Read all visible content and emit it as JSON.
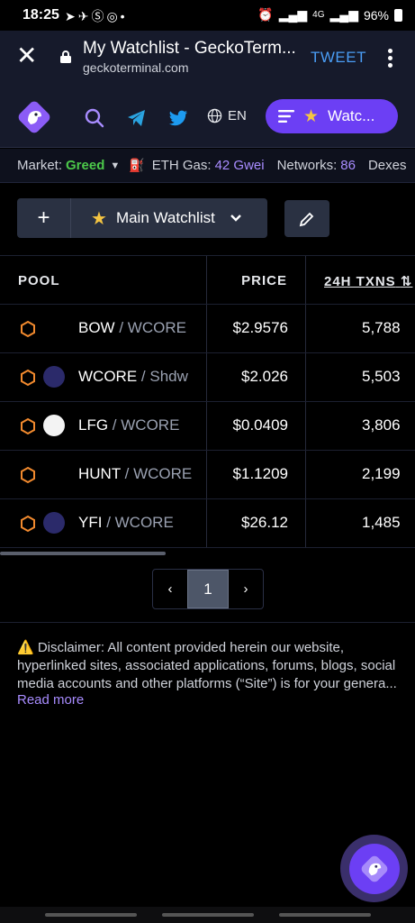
{
  "status_bar": {
    "time": "18:25",
    "notifications": [
      "navigation-icon",
      "telegram-icon",
      "skype-icon",
      "whatsapp-icon",
      "dot"
    ],
    "signal_text": "4G",
    "battery": "96%"
  },
  "browser": {
    "title": "My Watchlist - GeckoTerm...",
    "url": "geckoterminal.com",
    "action_label": "TWEET"
  },
  "header": {
    "language": "EN",
    "watchlist_button": "Watc..."
  },
  "market": {
    "market_label": "Market:",
    "market_value": "Greed",
    "gas_label": "ETH Gas:",
    "gas_value": "42 Gwei",
    "networks_label": "Networks:",
    "networks_value": "86",
    "dexes_label": "Dexes"
  },
  "watchlist": {
    "name": "Main Watchlist"
  },
  "table": {
    "columns": [
      "POOL",
      "PRICE",
      "24H TXNS"
    ],
    "rows": [
      {
        "base": "BOW",
        "quote": "WCORE",
        "price": "$2.9576",
        "txns": "5,788",
        "token_color": "#000000"
      },
      {
        "base": "WCORE",
        "quote": "Shdw",
        "price": "$2.026",
        "txns": "5,503",
        "token_color": "#2b2a6a"
      },
      {
        "base": "LFG",
        "quote": "WCORE",
        "price": "$0.0409",
        "txns": "3,806",
        "token_color": "#f3f3f3"
      },
      {
        "base": "HUNT",
        "quote": "WCORE",
        "price": "$1.1209",
        "txns": "2,199",
        "token_color": "#000000"
      },
      {
        "base": "YFI",
        "quote": "WCORE",
        "price": "$26.12",
        "txns": "1,485",
        "token_color": "#2b2a6a"
      }
    ]
  },
  "pagination": {
    "current_page": "1"
  },
  "disclaimer": {
    "text": "⚠️ Disclaimer: All content provided herein our website, hyperlinked sites, associated applications, forums, blogs, social media accounts and other platforms (“Site”) is for your genera...",
    "read_more": "Read more"
  },
  "colors": {
    "accent": "#6c3ff4",
    "greed": "#4cc84a",
    "link": "#a88cff",
    "hex_orange": "#f28a2e"
  }
}
